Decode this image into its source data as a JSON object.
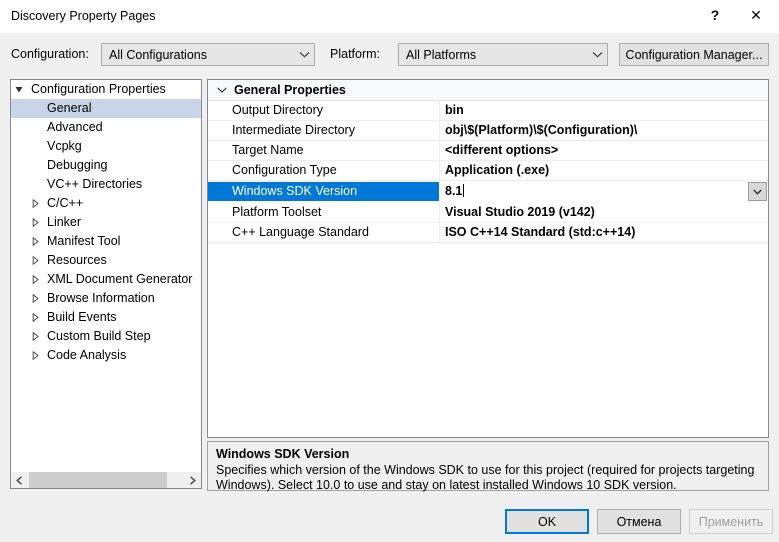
{
  "window": {
    "title": "Discovery Property Pages",
    "help_glyph": "?",
    "close_glyph": "✕"
  },
  "config_bar": {
    "configuration_label": "Configuration:",
    "configuration_value": "All Configurations",
    "platform_label": "Platform:",
    "platform_value": "All Platforms",
    "configuration_manager_label": "Configuration Manager..."
  },
  "tree": {
    "items": [
      {
        "label": "Configuration Properties",
        "depth": 0,
        "expander": "expanded",
        "selected": false
      },
      {
        "label": "General",
        "depth": 1,
        "expander": "none",
        "selected": true
      },
      {
        "label": "Advanced",
        "depth": 1,
        "expander": "none",
        "selected": false
      },
      {
        "label": "Vcpkg",
        "depth": 1,
        "expander": "none",
        "selected": false
      },
      {
        "label": "Debugging",
        "depth": 1,
        "expander": "none",
        "selected": false
      },
      {
        "label": "VC++ Directories",
        "depth": 1,
        "expander": "none",
        "selected": false
      },
      {
        "label": "C/C++",
        "depth": 1,
        "expander": "collapsed",
        "selected": false
      },
      {
        "label": "Linker",
        "depth": 1,
        "expander": "collapsed",
        "selected": false
      },
      {
        "label": "Manifest Tool",
        "depth": 1,
        "expander": "collapsed",
        "selected": false
      },
      {
        "label": "Resources",
        "depth": 1,
        "expander": "collapsed",
        "selected": false
      },
      {
        "label": "XML Document Generator",
        "depth": 1,
        "expander": "collapsed",
        "selected": false
      },
      {
        "label": "Browse Information",
        "depth": 1,
        "expander": "collapsed",
        "selected": false
      },
      {
        "label": "Build Events",
        "depth": 1,
        "expander": "collapsed",
        "selected": false
      },
      {
        "label": "Custom Build Step",
        "depth": 1,
        "expander": "collapsed",
        "selected": false
      },
      {
        "label": "Code Analysis",
        "depth": 1,
        "expander": "collapsed",
        "selected": false
      }
    ]
  },
  "grid": {
    "group_header": "General Properties",
    "rows": [
      {
        "name": "Output Directory",
        "value": "bin",
        "selected": false
      },
      {
        "name": "Intermediate Directory",
        "value": "obj\\$(Platform)\\$(Configuration)\\",
        "selected": false
      },
      {
        "name": "Target Name",
        "value": "<different options>",
        "selected": false
      },
      {
        "name": "Configuration Type",
        "value": "Application (.exe)",
        "selected": false
      },
      {
        "name": "Windows SDK Version",
        "value": "8.1",
        "selected": true
      },
      {
        "name": "Platform Toolset",
        "value": "Visual Studio 2019 (v142)",
        "selected": false
      },
      {
        "name": "C++ Language Standard",
        "value": "ISO C++14 Standard (std:c++14)",
        "selected": false
      }
    ]
  },
  "description": {
    "title": "Windows SDK Version",
    "body": "Specifies which version of the Windows SDK to use for this project (required for projects targeting Windows). Select 10.0 to use and stay on latest installed Windows 10 SDK version."
  },
  "footer": {
    "ok_label": "OK",
    "cancel_label": "Отмена",
    "apply_label": "Применить"
  },
  "colors": {
    "accent_selection": "#0078d7",
    "tree_selection": "#cbd5e8",
    "dialog_bg": "#f0f0f0",
    "panel_bg": "#ffffff"
  }
}
